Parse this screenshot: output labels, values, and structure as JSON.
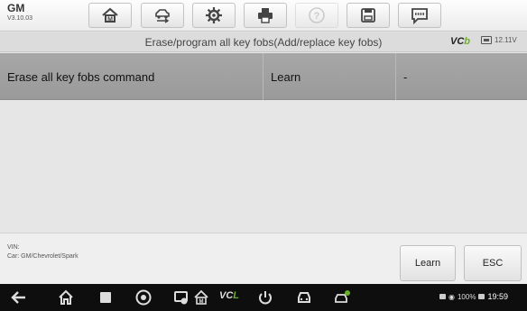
{
  "header": {
    "make": "GM",
    "version": "V3.10.03",
    "toolbar": [
      {
        "name": "home-button",
        "icon": "home-icon",
        "enabled": true
      },
      {
        "name": "vehicle-swap-button",
        "icon": "car-swap-icon",
        "enabled": true
      },
      {
        "name": "settings-button",
        "icon": "gear-icon",
        "enabled": true
      },
      {
        "name": "print-button",
        "icon": "printer-icon",
        "enabled": true
      },
      {
        "name": "help-button",
        "icon": "help-icon",
        "enabled": false
      },
      {
        "name": "save-button",
        "icon": "save-icon",
        "enabled": true
      },
      {
        "name": "data-logging-button",
        "icon": "message-icon",
        "enabled": true
      }
    ]
  },
  "titlebar": {
    "title": "Erase/program all key fobs(Add/replace key fobs)",
    "vci_label": "VC",
    "vci_suffix": "b",
    "battery_voltage": "12.11V"
  },
  "table": {
    "row": {
      "name": "Erase all key fobs command",
      "value": "Learn",
      "unit": "-"
    }
  },
  "footer": {
    "vin_label": "VIN:",
    "car_info": "Car: GM/Chevrolet/Spark",
    "learn_label": "Learn",
    "esc_label": "ESC"
  },
  "navbar": {
    "vcl_label": "VC",
    "vcl_suffix": "L",
    "battery_percent": "100%",
    "clock": "19:59"
  },
  "colors": {
    "vci_green": "#6ab02a",
    "row_bg": "#a0a0a0",
    "navbar_bg": "#0e0e0e"
  }
}
